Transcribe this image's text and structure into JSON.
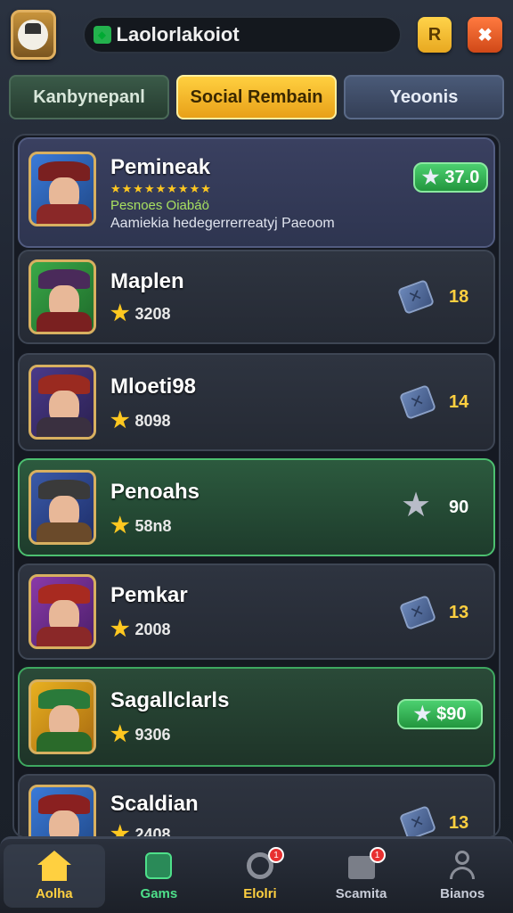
{
  "topbar": {
    "player_name": "Laolorlakoiot",
    "btn_yellow_label": "R",
    "btn_orange_label": "✖"
  },
  "tabs": [
    {
      "label": "Kanbynepanl"
    },
    {
      "label": "Social Rembain"
    },
    {
      "label": "Yeoonis"
    }
  ],
  "list": {
    "first": {
      "name": "Pemineak",
      "stars": "★★★★★★★★★",
      "subtitle": "Pesnoes Oiabáö",
      "description": "Aamiekia hedegerrerreatyj Paeoom",
      "pill_value": "37.0"
    },
    "rows": [
      {
        "name": "Maplen",
        "score": "3208",
        "value": "18"
      },
      {
        "name": "Mloeti98",
        "score": "8098",
        "value": "14"
      },
      {
        "name": "Penoahs",
        "score": "58n8",
        "value": "90"
      },
      {
        "name": "Pemkar",
        "score": "2008",
        "value": "13"
      },
      {
        "name": "Sagallclarls",
        "score": "9306",
        "value": "$90"
      },
      {
        "name": "Scaldian",
        "score": "2408",
        "value": "13"
      }
    ]
  },
  "bottomnav": {
    "items": [
      {
        "label": "Aolha",
        "color": "#ffd040"
      },
      {
        "label": "Gams",
        "color": "#4ee08a"
      },
      {
        "label": "Elolri",
        "color": "#ffd040",
        "badge": "1"
      },
      {
        "label": "Scamita",
        "color": "#c8ccd8",
        "badge": "1"
      },
      {
        "label": "Bianos",
        "color": "#c8ccd8"
      }
    ]
  },
  "colors": {
    "accent_yellow": "#ffd040",
    "accent_green": "#4cd070",
    "panel_bg": "#1e2430"
  }
}
